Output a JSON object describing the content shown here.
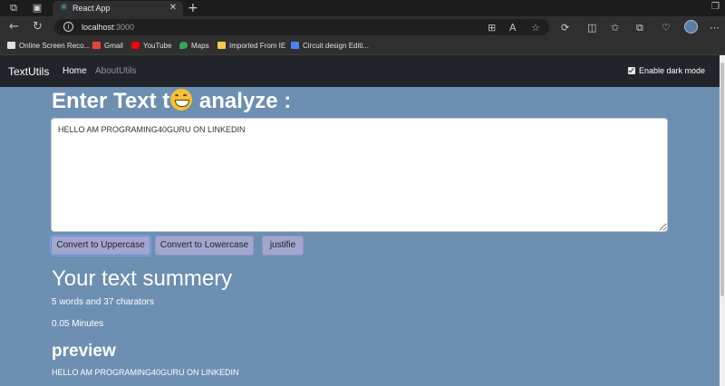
{
  "browser": {
    "tab_title": "React App",
    "url_host": "localhost",
    "url_port": ":3000",
    "bookmarks": [
      {
        "label": "Online Screen Reco...",
        "color": "#e0e0e0"
      },
      {
        "label": "Gmail",
        "color": "#ea4335"
      },
      {
        "label": "YouTube",
        "color": "#ff0000"
      },
      {
        "label": "Maps",
        "color": "#34a853"
      },
      {
        "label": "Imported From IE",
        "color": "#f2c94c"
      },
      {
        "label": "Circuit design Editi...",
        "color": "#4285f4"
      }
    ]
  },
  "navbar": {
    "brand": "TextUtils",
    "links": [
      "Home",
      "AboutUtils"
    ],
    "dark_mode_label": "Enable dark mode",
    "dark_mode_checked": true
  },
  "form": {
    "heading_before": "Enter Text t",
    "heading_after": " analyze :",
    "text_value": "HELLO AM PROGRAMING40GURU ON LINKEDIN",
    "buttons": [
      "Convert to Uppercase",
      "Convert to Lowercase",
      "justifie"
    ]
  },
  "summary": {
    "title": "Your text summery",
    "word_stats": "5 words and 37 charators",
    "minutes": "0.05 Minutes",
    "preview_title": "preview",
    "preview_text": "HELLO AM PROGRAMING40GURU ON LINKEDIN"
  },
  "colors": {
    "page_bg": "#6c8fb2",
    "navbar_bg": "#212529",
    "button_bg": "#a3a6cf"
  }
}
